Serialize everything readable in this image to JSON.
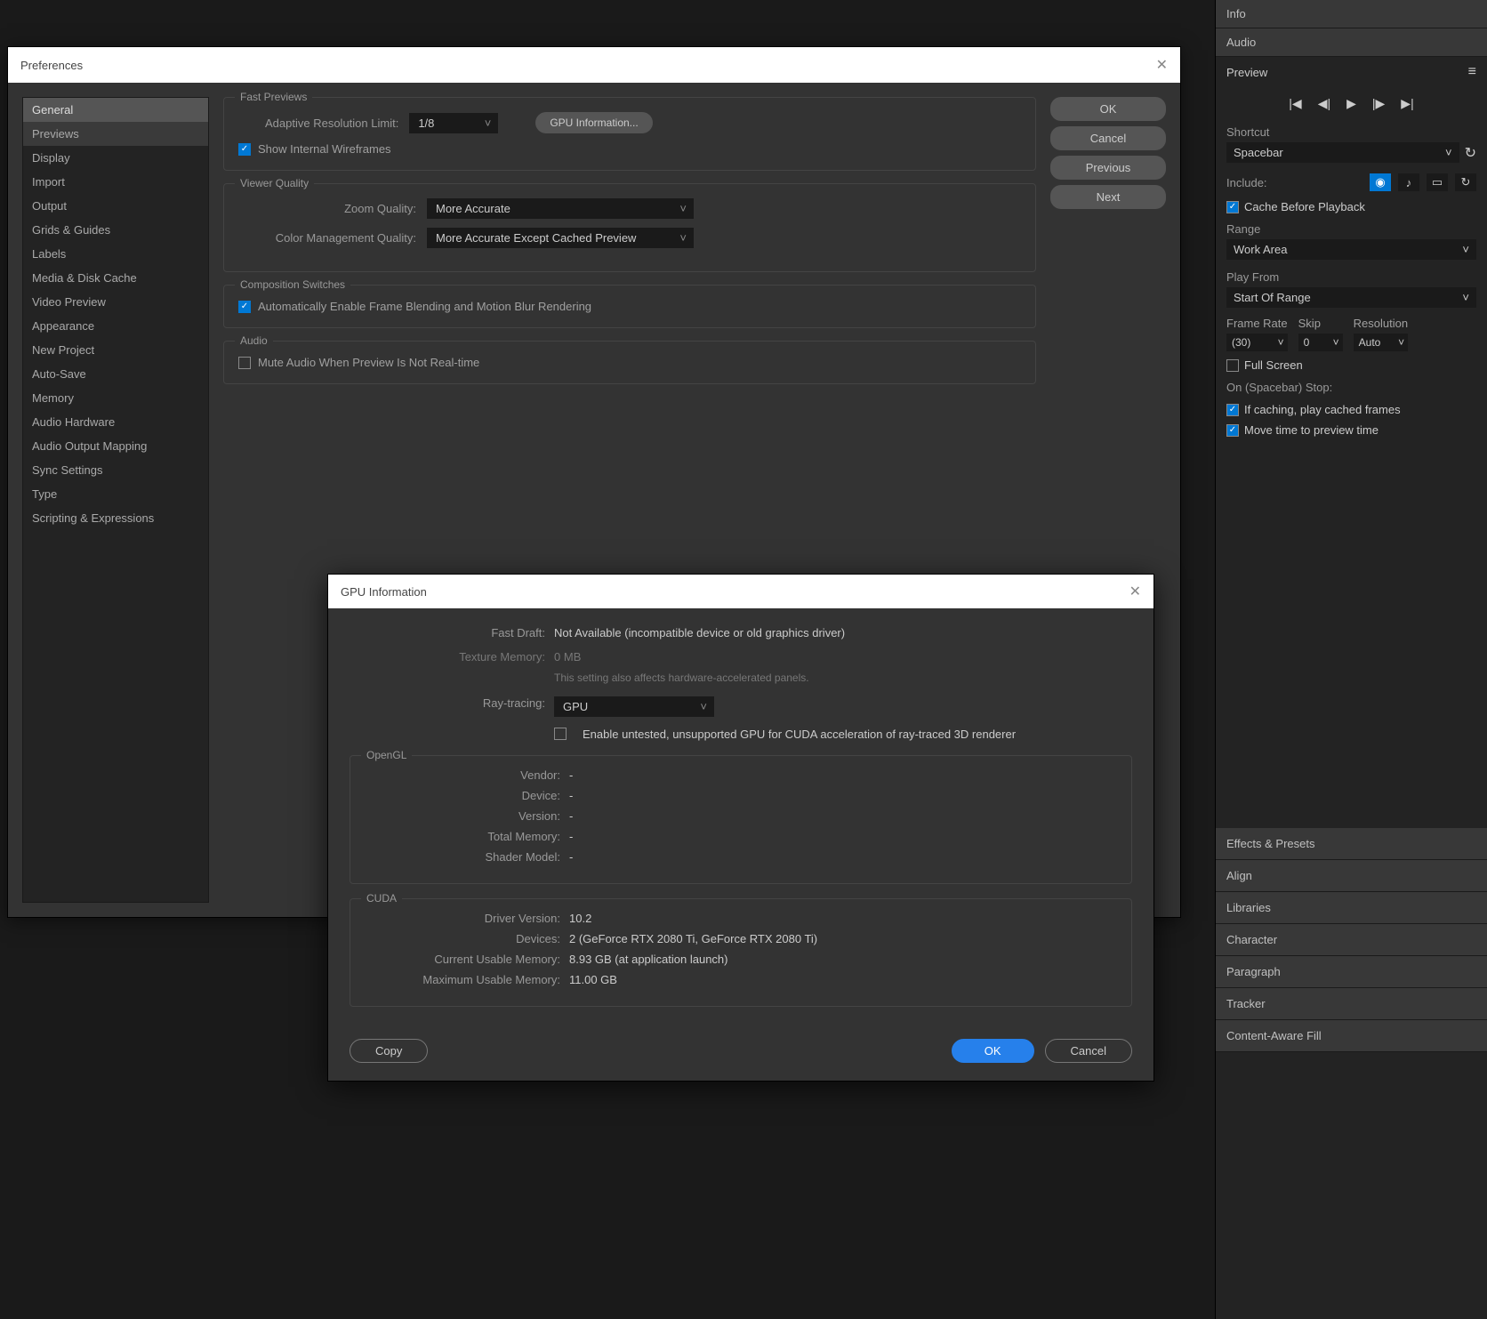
{
  "rightPanel": {
    "infoTab": "Info",
    "audioTab": "Audio",
    "previewTab": "Preview",
    "shortcut": {
      "label": "Shortcut",
      "value": "Spacebar"
    },
    "include": {
      "label": "Include:"
    },
    "cacheBefore": "Cache Before Playback",
    "range": {
      "label": "Range",
      "value": "Work Area"
    },
    "playFrom": {
      "label": "Play From",
      "value": "Start Of Range"
    },
    "frameRate": {
      "label": "Frame Rate",
      "value": "(30)"
    },
    "skip": {
      "label": "Skip",
      "value": "0"
    },
    "resolution": {
      "label": "Resolution",
      "value": "Auto"
    },
    "fullScreen": "Full Screen",
    "onStop": "On (Spacebar) Stop:",
    "ifCaching": "If caching, play cached frames",
    "moveTime": "Move time to preview time",
    "collapsedPanels": [
      "Effects & Presets",
      "Align",
      "Libraries",
      "Character",
      "Paragraph",
      "Tracker",
      "Content-Aware Fill"
    ]
  },
  "prefs": {
    "title": "Preferences",
    "sidebar": [
      "General",
      "Previews",
      "Display",
      "Import",
      "Output",
      "Grids & Guides",
      "Labels",
      "Media & Disk Cache",
      "Video Preview",
      "Appearance",
      "New Project",
      "Auto-Save",
      "Memory",
      "Audio Hardware",
      "Audio Output Mapping",
      "Sync Settings",
      "Type",
      "Scripting & Expressions"
    ],
    "buttons": {
      "ok": "OK",
      "cancel": "Cancel",
      "previous": "Previous",
      "next": "Next"
    },
    "fastPreviews": {
      "legend": "Fast Previews",
      "adaptiveLabel": "Adaptive Resolution Limit:",
      "adaptiveValue": "1/8",
      "gpuBtn": "GPU Information...",
      "wireframes": "Show Internal Wireframes"
    },
    "viewerQuality": {
      "legend": "Viewer Quality",
      "zoomLabel": "Zoom Quality:",
      "zoomValue": "More Accurate",
      "colorLabel": "Color Management Quality:",
      "colorValue": "More Accurate Except Cached Preview"
    },
    "compSwitches": {
      "legend": "Composition Switches",
      "autoBlend": "Automatically Enable Frame Blending and Motion Blur Rendering"
    },
    "audio": {
      "legend": "Audio",
      "mute": "Mute Audio When Preview Is Not Real-time"
    }
  },
  "gpu": {
    "title": "GPU Information",
    "fastDraft": {
      "label": "Fast Draft:",
      "value": "Not Available (incompatible device or old graphics driver)"
    },
    "textureMemory": {
      "label": "Texture Memory:",
      "value": "0",
      "unit": "MB"
    },
    "note": "This setting also affects hardware-accelerated panels.",
    "rayTracing": {
      "label": "Ray-tracing:",
      "value": "GPU"
    },
    "enableUntested": "Enable untested, unsupported GPU for CUDA acceleration of ray-traced 3D renderer",
    "opengl": {
      "legend": "OpenGL",
      "vendor": {
        "label": "Vendor:",
        "value": "-"
      },
      "device": {
        "label": "Device:",
        "value": "-"
      },
      "version": {
        "label": "Version:",
        "value": "-"
      },
      "totalMemory": {
        "label": "Total Memory:",
        "value": "-"
      },
      "shaderModel": {
        "label": "Shader Model:",
        "value": "-"
      }
    },
    "cuda": {
      "legend": "CUDA",
      "driverVersion": {
        "label": "Driver Version:",
        "value": "10.2"
      },
      "devices": {
        "label": "Devices:",
        "value": "2 (GeForce RTX 2080 Ti, GeForce RTX 2080 Ti)"
      },
      "currentUsable": {
        "label": "Current Usable Memory:",
        "value": "8.93 GB (at application launch)"
      },
      "maxUsable": {
        "label": "Maximum Usable Memory:",
        "value": "11.00 GB"
      }
    },
    "buttons": {
      "copy": "Copy",
      "ok": "OK",
      "cancel": "Cancel"
    }
  }
}
